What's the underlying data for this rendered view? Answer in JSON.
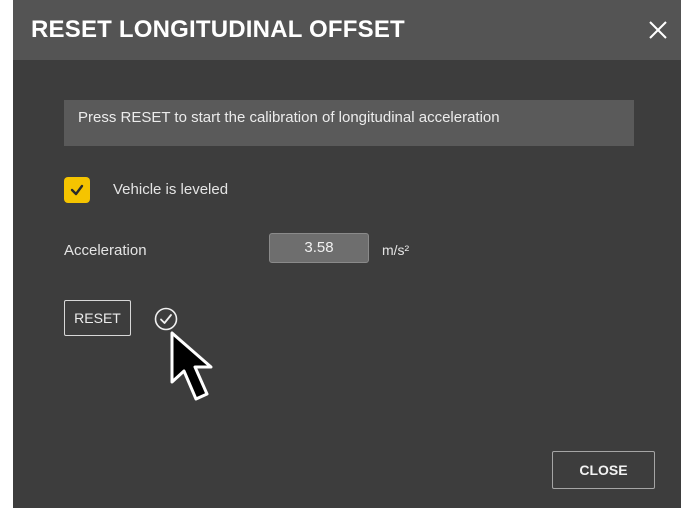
{
  "dialog": {
    "title": "RESET LONGITUDINAL OFFSET",
    "close_icon": "close-icon"
  },
  "info": {
    "text": "Press RESET to start the calibration of longitudinal acceleration"
  },
  "vehicle_leveled": {
    "label": "Vehicle is leveled",
    "checked": true,
    "icon": "checkmark-icon",
    "color": "#f5c400"
  },
  "acceleration": {
    "label": "Acceleration",
    "value": "3.58",
    "unit": "m/s²"
  },
  "actions": {
    "reset_label": "RESET",
    "status_icon": "check-circle-icon",
    "close_label": "CLOSE"
  },
  "colors": {
    "dialog_bg": "#3d3d3d",
    "titlebar_bg": "#545454",
    "info_bg": "#5a5a5a",
    "accent": "#f5c400"
  }
}
